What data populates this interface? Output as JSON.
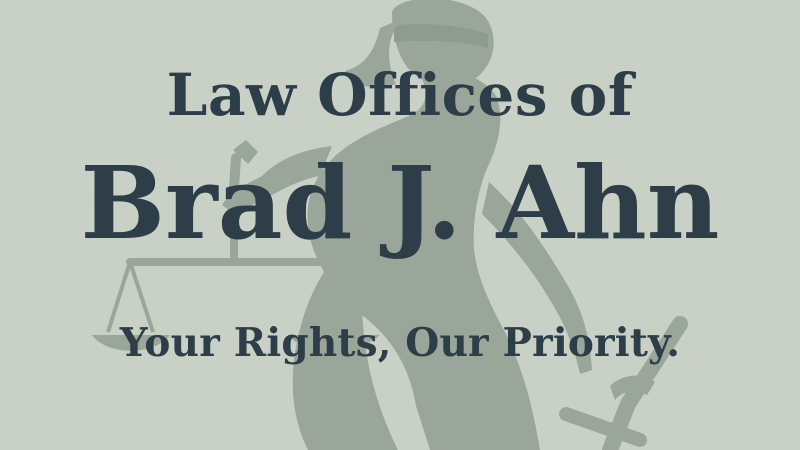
{
  "banner": {
    "line1": "Law Offices of",
    "line2": "Brad J. Ahn",
    "tagline": "Your Rights, Our Priority."
  },
  "colors": {
    "background": "#c9d1c7",
    "figure": "#9aa69a",
    "text": "#2d3e48"
  },
  "icons": {
    "background_graphic": "lady-justice-icon"
  }
}
